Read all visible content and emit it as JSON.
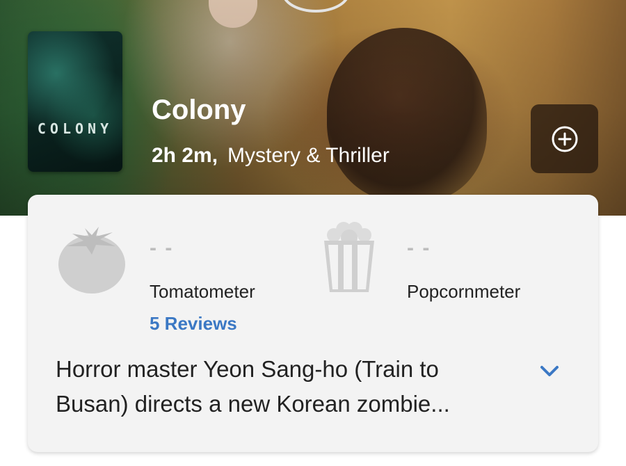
{
  "movie": {
    "title": "Colony",
    "runtime": "2h 2m,",
    "genre": "Mystery & Thriller",
    "poster_text": "COLONY"
  },
  "actions": {
    "add_icon": "plus-circle-icon"
  },
  "ratings": {
    "tomatometer": {
      "score": "- -",
      "label": "Tomatometer",
      "reviews_link": "5 Reviews",
      "icon": "tomato-icon"
    },
    "popcornmeter": {
      "score": "- -",
      "label": "Popcornmeter",
      "icon": "popcorn-icon"
    }
  },
  "synopsis": {
    "text": "Horror master Yeon Sang-ho (Train to Busan) directs a new Korean zombie...",
    "expand_icon": "chevron-down-icon"
  },
  "colors": {
    "link": "#3b78c4",
    "card_bg": "#f3f3f3",
    "icon_gray": "#cfcfcf"
  }
}
